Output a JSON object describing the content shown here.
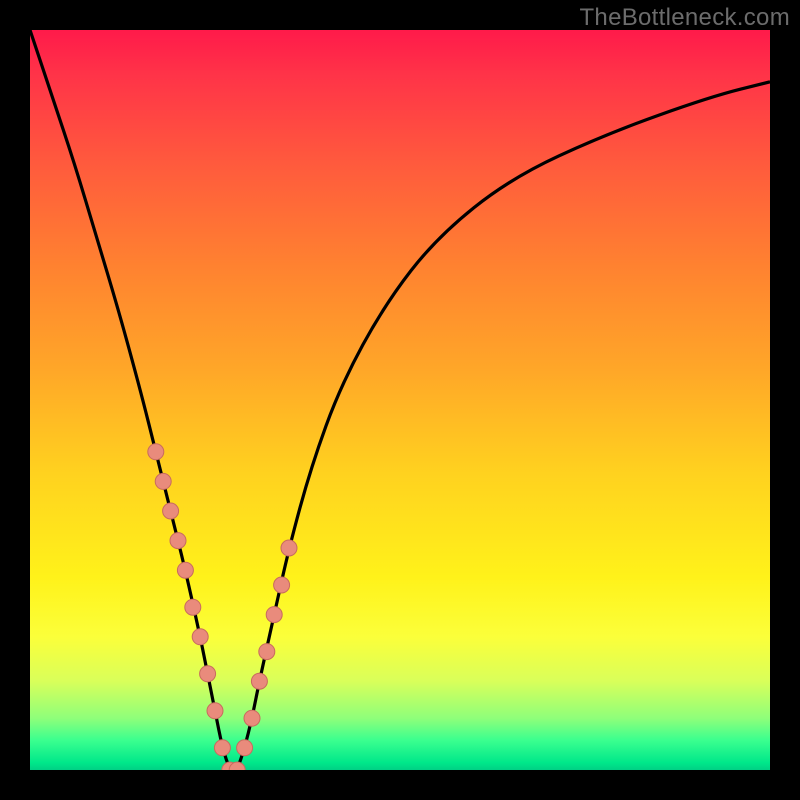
{
  "watermark": "TheBottleneck.com",
  "colors": {
    "frame": "#000000",
    "curve": "#000000",
    "dot_fill": "#e98b7c",
    "dot_stroke": "#c86b5e",
    "gradient_top": "#ff1a4a",
    "gradient_bottom": "#00d085"
  },
  "chart_data": {
    "type": "line",
    "title": "",
    "xlabel": "",
    "ylabel": "",
    "xlim": [
      0,
      100
    ],
    "ylim": [
      0,
      100
    ],
    "note": "V-shaped bottleneck curve; value drops to ~0 near x≈27 and bottleneck grows on either side. No axis ticks or numeric labels shown.",
    "x": [
      0,
      3,
      6,
      9,
      12,
      15,
      17,
      19,
      21,
      23,
      24,
      25,
      26,
      27,
      28,
      29,
      30,
      31,
      33,
      35,
      38,
      42,
      48,
      55,
      65,
      78,
      92,
      100
    ],
    "y": [
      100,
      91,
      82,
      72,
      62,
      51,
      43,
      35,
      27,
      18,
      13,
      8,
      3,
      0,
      0,
      3,
      7,
      12,
      21,
      30,
      41,
      52,
      63,
      72,
      80,
      86,
      91,
      93
    ],
    "series": [
      {
        "name": "scatter-markers",
        "x": [
          17,
          18,
          19,
          20,
          21,
          22,
          23,
          24,
          25,
          26,
          27,
          28,
          29,
          30,
          31,
          32,
          33,
          34,
          35
        ],
        "y": [
          43,
          39,
          35,
          31,
          27,
          22,
          18,
          13,
          8,
          3,
          0,
          0,
          3,
          7,
          12,
          16,
          21,
          25,
          30
        ]
      }
    ]
  }
}
